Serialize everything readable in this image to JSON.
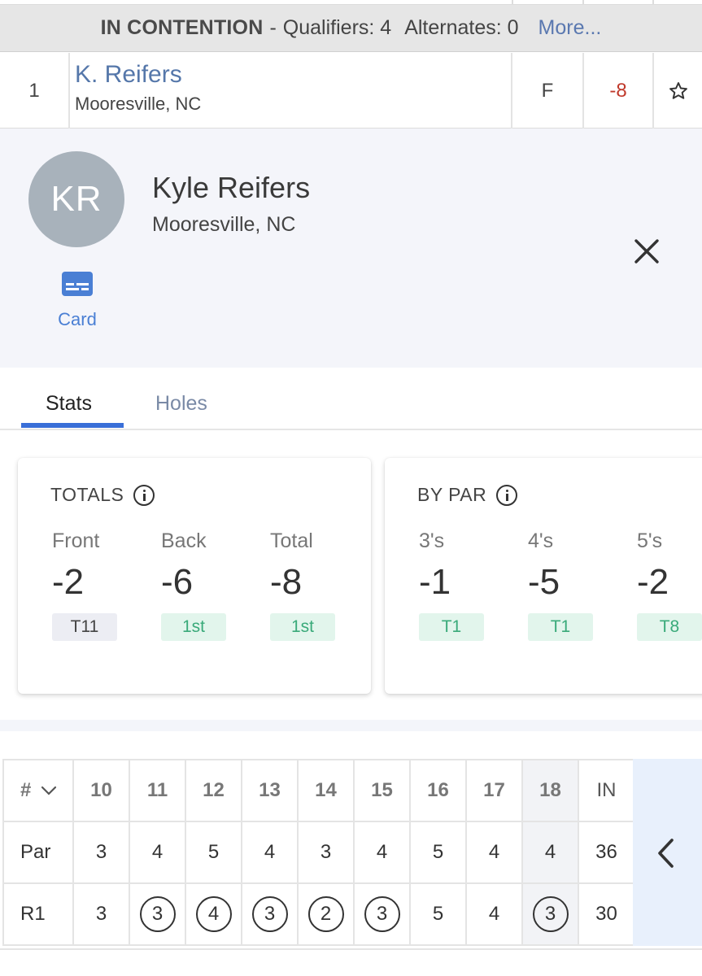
{
  "banner": {
    "title": "IN CONTENTION",
    "separator": "-",
    "qualifiers": "Qualifiers: 4",
    "alternates": "Alternates: 0",
    "more": "More..."
  },
  "player_row": {
    "position": "1",
    "name": "K. Reifers",
    "location": "Mooresville, NC",
    "thru": "F",
    "score": "-8",
    "score_color": "#c0392b",
    "favorite_icon": "star-outline-icon"
  },
  "profile": {
    "initials": "KR",
    "full_name": "Kyle Reifers",
    "location": "Mooresville, NC",
    "card_label": "Card",
    "card_icon": "scorecard-icon",
    "close_icon": "close-icon"
  },
  "tabs": [
    {
      "label": "Stats",
      "active": true
    },
    {
      "label": "Holes",
      "active": false
    }
  ],
  "totals": {
    "heading": "TOTALS",
    "columns": [
      {
        "label": "Front",
        "value": "-2",
        "rank": "T11",
        "rank_style": "gray"
      },
      {
        "label": "Back",
        "value": "-6",
        "rank": "1st",
        "rank_style": "green"
      },
      {
        "label": "Total",
        "value": "-8",
        "rank": "1st",
        "rank_style": "green"
      }
    ]
  },
  "by_par": {
    "heading": "BY PAR",
    "columns": [
      {
        "label": "3's",
        "value": "-1",
        "rank": "T1",
        "rank_style": "green"
      },
      {
        "label": "4's",
        "value": "-5",
        "rank": "T1",
        "rank_style": "green"
      },
      {
        "label": "5's",
        "value": "-2",
        "rank": "T8",
        "rank_style": "green"
      }
    ]
  },
  "scorecard": {
    "header_label": "#",
    "holes": [
      "10",
      "11",
      "12",
      "13",
      "14",
      "15",
      "16",
      "17",
      "18",
      "IN"
    ],
    "par_label": "Par",
    "par": [
      "3",
      "4",
      "5",
      "4",
      "3",
      "4",
      "5",
      "4",
      "4",
      "36"
    ],
    "round_label": "R1",
    "round": [
      "3",
      "3",
      "4",
      "3",
      "2",
      "3",
      "5",
      "4",
      "3",
      "30"
    ],
    "birdies": [
      false,
      true,
      true,
      true,
      true,
      true,
      false,
      false,
      true,
      false
    ],
    "nav_icon": "chevron-left-icon"
  },
  "colors": {
    "accent": "#3a6fd8",
    "link": "#5577aa",
    "under_par": "#c0392b",
    "rank_green": "#3aaa7a"
  }
}
